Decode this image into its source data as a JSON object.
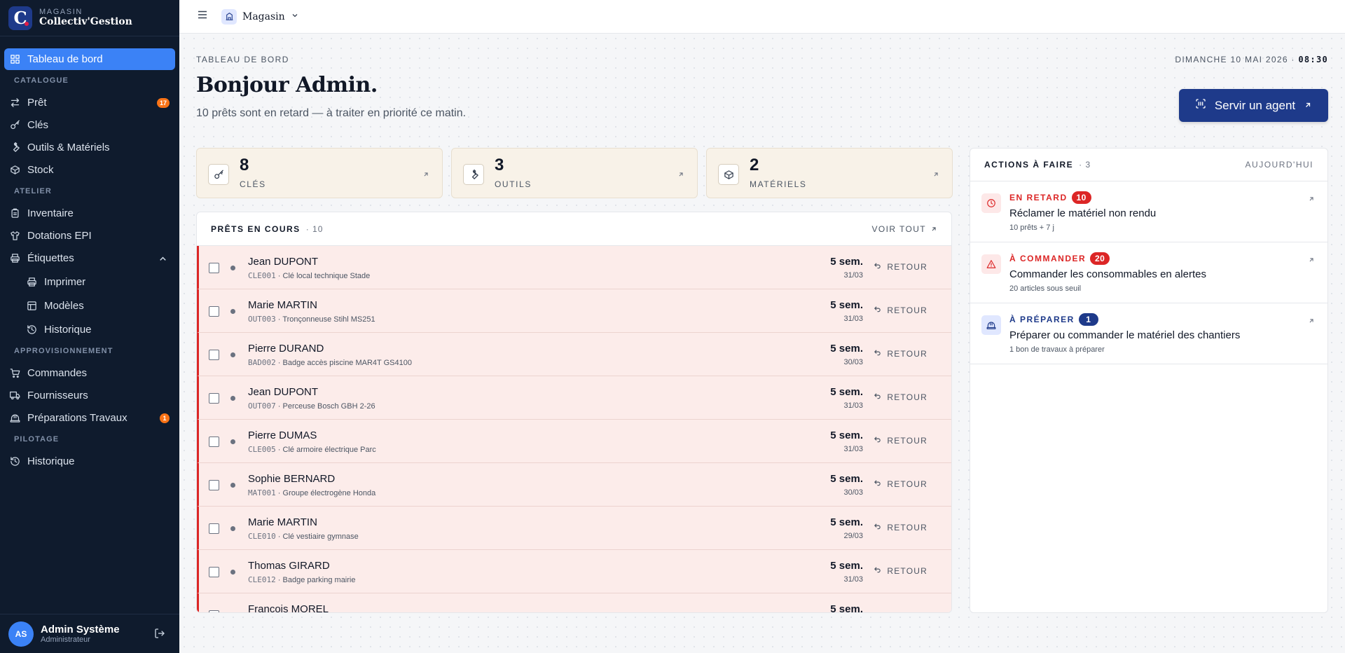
{
  "brand": {
    "kicker": "MAGASIN",
    "name": "Collectiv'Gestion",
    "logo_letter": "C"
  },
  "sidebar": {
    "items": [
      {
        "id": "dashboard",
        "label": "Tableau de bord",
        "icon": "grid-icon",
        "active": true
      },
      {
        "section": "CATALOGUE"
      },
      {
        "id": "pret",
        "label": "Prêt",
        "icon": "swap-icon",
        "badge": "17"
      },
      {
        "id": "cles",
        "label": "Clés",
        "icon": "key-icon"
      },
      {
        "id": "outils",
        "label": "Outils & Matériels",
        "icon": "wrench-icon"
      },
      {
        "id": "stock",
        "label": "Stock",
        "icon": "box-icon"
      },
      {
        "section": "ATELIER"
      },
      {
        "id": "inventaire",
        "label": "Inventaire",
        "icon": "clipboard-icon"
      },
      {
        "id": "epi",
        "label": "Dotations EPI",
        "icon": "shirt-icon"
      },
      {
        "id": "etiquettes",
        "label": "Étiquettes",
        "icon": "printer-icon",
        "expanded": true
      },
      {
        "id": "imprimer",
        "label": "Imprimer",
        "icon": "printer-icon",
        "sub": true
      },
      {
        "id": "modeles",
        "label": "Modèles",
        "icon": "template-icon",
        "sub": true
      },
      {
        "id": "historique-etiq",
        "label": "Historique",
        "icon": "history-icon",
        "sub": true
      },
      {
        "section": "APPROVISIONNEMENT"
      },
      {
        "id": "commandes",
        "label": "Commandes",
        "icon": "cart-icon"
      },
      {
        "id": "fournisseurs",
        "label": "Fournisseurs",
        "icon": "truck-icon"
      },
      {
        "id": "preparations",
        "label": "Préparations Travaux",
        "icon": "hardhat-icon",
        "badge": "1"
      },
      {
        "section": "PILOTAGE"
      },
      {
        "id": "historique",
        "label": "Historique",
        "icon": "history-icon"
      }
    ]
  },
  "user": {
    "initials": "AS",
    "name": "Admin Système",
    "role": "Administrateur"
  },
  "topbar": {
    "store": "Magasin"
  },
  "header": {
    "kicker": "TABLEAU DE BORD",
    "date": "DIMANCHE 10 MAI 2026 · ",
    "time": "08:30",
    "greeting": "Bonjour ",
    "greeting_name": "Admin.",
    "subtitle": "10 prêts sont en retard — à traiter en priorité ce matin.",
    "cta": "Servir un agent"
  },
  "stats": [
    {
      "value": "8",
      "label": "CLÉS",
      "icon": "key-icon"
    },
    {
      "value": "3",
      "label": "OUTILS",
      "icon": "wrench-icon"
    },
    {
      "value": "2",
      "label": "MATÉRIELS",
      "icon": "box-icon"
    }
  ],
  "loans": {
    "title": "PRÊTS EN COURS",
    "count": "· 10",
    "see_all": "VOIR TOUT",
    "return_label": "RETOUR",
    "rows": [
      {
        "name": "Jean DUPONT",
        "code": "CLE001",
        "item": "Clé local technique Stade",
        "duration": "5 sem.",
        "date": "31/03"
      },
      {
        "name": "Marie MARTIN",
        "code": "OUT003",
        "item": "Tronçonneuse Stihl MS251",
        "duration": "5 sem.",
        "date": "31/03"
      },
      {
        "name": "Pierre DURAND",
        "code": "BAD002",
        "item": "Badge accès piscine MAR4T GS4100",
        "duration": "5 sem.",
        "date": "30/03"
      },
      {
        "name": "Jean DUPONT",
        "code": "OUT007",
        "item": "Perceuse Bosch GBH 2-26",
        "duration": "5 sem.",
        "date": "31/03"
      },
      {
        "name": "Pierre DUMAS",
        "code": "CLE005",
        "item": "Clé armoire électrique Parc",
        "duration": "5 sem.",
        "date": "31/03"
      },
      {
        "name": "Sophie BERNARD",
        "code": "MAT001",
        "item": "Groupe électrogène Honda",
        "duration": "5 sem.",
        "date": "30/03"
      },
      {
        "name": "Marie MARTIN",
        "code": "CLE010",
        "item": "Clé vestiaire gymnase",
        "duration": "5 sem.",
        "date": "29/03"
      },
      {
        "name": "Thomas GIRARD",
        "code": "CLE012",
        "item": "Badge parking mairie",
        "duration": "5 sem.",
        "date": "31/03"
      },
      {
        "name": "Francois MOREL",
        "code": "",
        "item": "",
        "duration": "5 sem.",
        "date": ""
      }
    ]
  },
  "actions": {
    "title": "ACTIONS À FAIRE",
    "count": "· 3",
    "today": "AUJOURD'HUI",
    "tasks": [
      {
        "label": "EN RETARD",
        "badge": "10",
        "title": "Réclamer le matériel non rendu",
        "sub": "10 prêts + 7 j",
        "color": "#dc2626",
        "bg": "#fde8e8",
        "icon": "clock-icon"
      },
      {
        "label": "À COMMANDER",
        "badge": "20",
        "title": "Commander les consommables en alertes",
        "sub": "20 articles sous seuil",
        "color": "#dc2626",
        "bg": "#fde8e8",
        "icon": "alert-icon"
      },
      {
        "label": "À PRÉPARER",
        "badge": "1",
        "title": "Préparer ou commander le matériel des chantiers",
        "sub": "1 bon de travaux à préparer",
        "color": "#1e3a8a",
        "bg": "#e0e7ff",
        "icon": "hardhat-icon"
      }
    ]
  }
}
